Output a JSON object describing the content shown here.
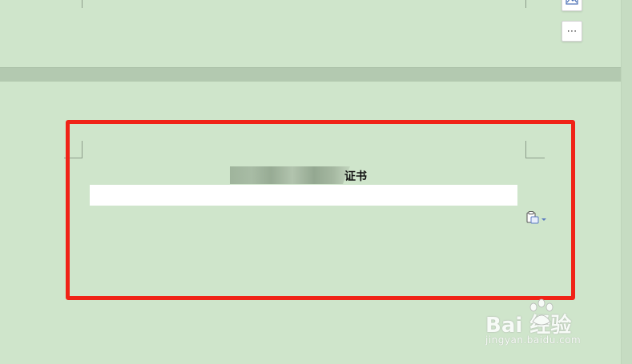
{
  "document": {
    "heading_visible_suffix": "证书"
  },
  "side_toolbar": {
    "more_label": "⋯"
  },
  "watermark": {
    "brand": "Bai  经验",
    "url": "jingyan.baidu.com"
  },
  "colors": {
    "page_background": "#cfe5cb",
    "page_gap": "#b3c9b0",
    "annotation_red": "#f02317",
    "paste_icon_blue": "#5a7ac0"
  },
  "icons": {
    "image_tool": "image-icon",
    "more": "more-icon",
    "paste_options": "clipboard-icon"
  }
}
